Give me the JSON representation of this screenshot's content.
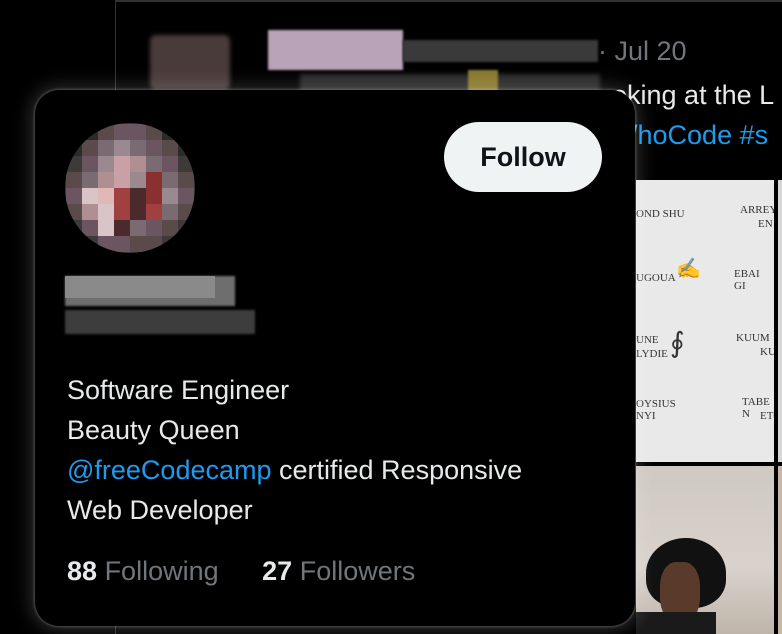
{
  "background": {
    "tweet": {
      "date": "· Jul 20",
      "text_line1": "oking at the L",
      "text_line2": "/hoCode #s"
    },
    "doc_image": {
      "names": [
        "OND SHU",
        "ARREY",
        "EN",
        "UGOUA",
        "EBAI GI",
        "UNE",
        "LYDIE",
        "KUUM",
        "KU",
        "OYSIUS",
        "NYI",
        "TABE N",
        "ETO"
      ]
    }
  },
  "hover_card": {
    "follow_label": "Follow",
    "bio": {
      "line1": "Software Engineer",
      "line2": "Beauty Queen",
      "mention": "@freeCodecamp",
      "line3_rest": " certified Responsive",
      "line4": "Web Developer"
    },
    "stats": {
      "following_count": "88",
      "following_label": "Following",
      "followers_count": "27",
      "followers_label": "Followers"
    }
  },
  "colors": {
    "accent": "#1d9bf0",
    "background": "#000000",
    "text_primary": "#e7e9ea",
    "text_secondary": "#71767b",
    "follow_button_bg": "#eff3f4"
  }
}
